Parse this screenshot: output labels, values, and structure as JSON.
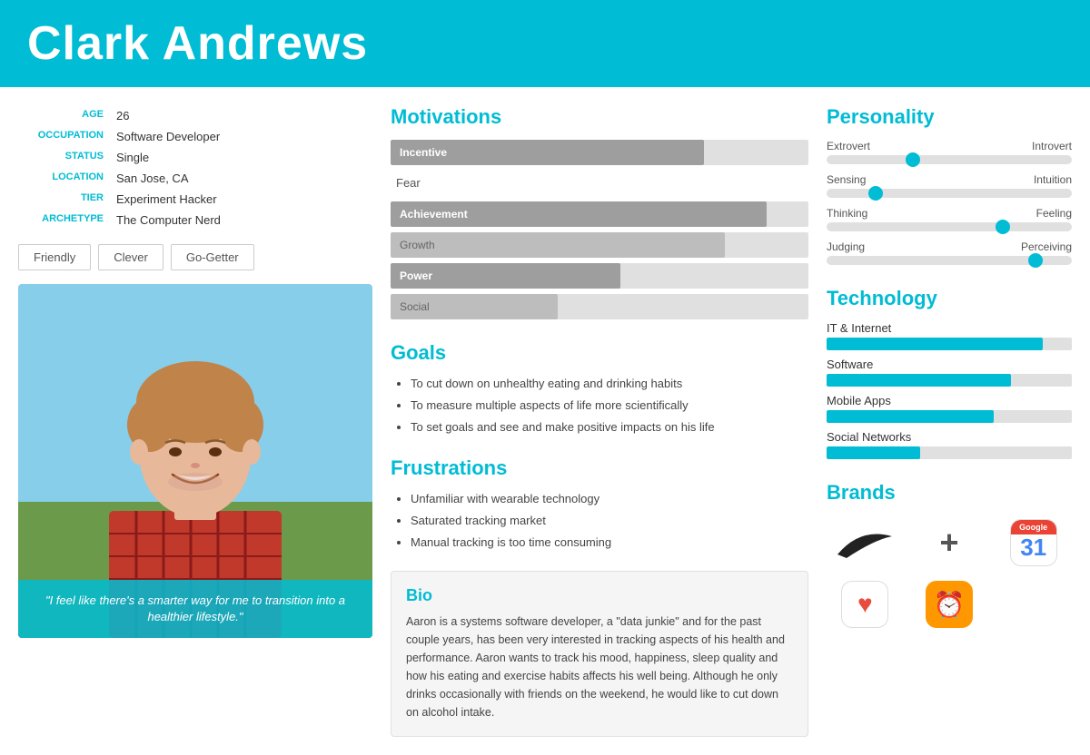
{
  "header": {
    "name": "Clark Andrews"
  },
  "profile": {
    "age_label": "AGE",
    "age": "26",
    "occupation_label": "OCCUPATION",
    "occupation": "Software Developer",
    "status_label": "STATUS",
    "status": "Single",
    "location_label": "LOCATION",
    "location": "San Jose, CA",
    "tier_label": "TIER",
    "tier": "Experiment Hacker",
    "archetype_label": "ARCHETYPE",
    "archetype": "The Computer Nerd"
  },
  "traits": [
    "Friendly",
    "Clever",
    "Go-Getter"
  ],
  "quote": "\"I feel like there's a smarter way for me to transition into a healthier lifestyle.\"",
  "motivations": {
    "title": "Motivations",
    "items": [
      {
        "label": "Incentive",
        "type": "bar",
        "value": 75
      },
      {
        "label": "Fear",
        "type": "plain"
      },
      {
        "label": "Achievement",
        "type": "bar",
        "value": 90
      },
      {
        "label": "Growth",
        "type": "plain-bar",
        "value": 80
      },
      {
        "label": "Power",
        "type": "bar",
        "value": 55
      },
      {
        "label": "Social",
        "type": "plain-bar",
        "value": 40
      }
    ]
  },
  "goals": {
    "title": "Goals",
    "items": [
      "To cut down on unhealthy eating and drinking habits",
      "To measure multiple aspects of life more scientifically",
      "To set goals and see and make positive impacts on his life"
    ]
  },
  "frustrations": {
    "title": "Frustrations",
    "items": [
      "Unfamiliar with wearable technology",
      "Saturated tracking market",
      "Manual tracking is too time consuming"
    ]
  },
  "bio": {
    "title": "Bio",
    "text": "Aaron is a systems software developer, a \"data junkie\" and for the past couple years, has been very interested in tracking aspects of his health and performance. Aaron wants to track his mood, happiness, sleep quality and how his eating and exercise habits affects his well being. Although he only drinks occasionally with friends on the weekend, he would like to cut down on alcohol intake."
  },
  "personality": {
    "title": "Personality",
    "rows": [
      {
        "left": "Extrovert",
        "right": "Introvert",
        "position": 35
      },
      {
        "left": "Sensing",
        "right": "Intuition",
        "position": 20
      },
      {
        "left": "Thinking",
        "right": "Feeling",
        "position": 72
      },
      {
        "left": "Judging",
        "right": "Perceiving",
        "position": 85
      }
    ]
  },
  "technology": {
    "title": "Technology",
    "items": [
      {
        "label": "IT & Internet",
        "value": 88
      },
      {
        "label": "Software",
        "value": 75
      },
      {
        "label": "Mobile Apps",
        "value": 68
      },
      {
        "label": "Social Networks",
        "value": 38
      }
    ]
  },
  "brands": {
    "title": "Brands"
  }
}
